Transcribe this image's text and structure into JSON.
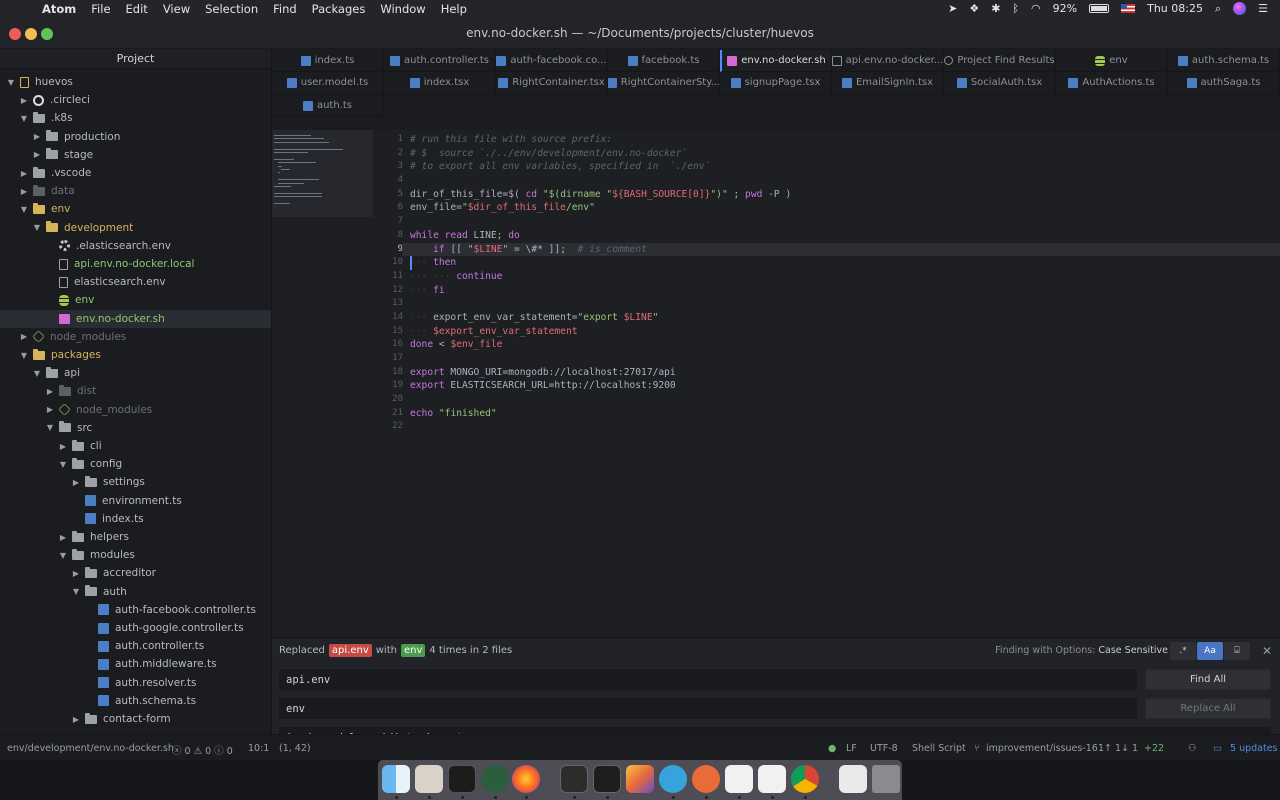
{
  "menubar": {
    "app": "Atom",
    "items": [
      "File",
      "Edit",
      "View",
      "Selection",
      "Find",
      "Packages",
      "Window",
      "Help"
    ],
    "battery": "92%",
    "clock": "Thu 08:25"
  },
  "window": {
    "title": "env.no-docker.sh — ~/Documents/projects/cluster/huevos"
  },
  "sidebar": {
    "header": "Project",
    "rows": [
      {
        "label": "huevos",
        "depth": 0,
        "chev": "down",
        "icon": "repo"
      },
      {
        "label": ".circleci",
        "depth": 1,
        "chev": "right",
        "icon": "ci"
      },
      {
        "label": ".k8s",
        "depth": 1,
        "chev": "down",
        "icon": "folder"
      },
      {
        "label": "production",
        "depth": 2,
        "chev": "right",
        "icon": "folder"
      },
      {
        "label": "stage",
        "depth": 2,
        "chev": "right",
        "icon": "folder"
      },
      {
        "label": ".vscode",
        "depth": 1,
        "chev": "right",
        "icon": "folder"
      },
      {
        "label": "data",
        "depth": 1,
        "chev": "right",
        "icon": "folder-dim",
        "dim": true
      },
      {
        "label": "env",
        "depth": 1,
        "chev": "down",
        "icon": "folder-y",
        "color": "orange"
      },
      {
        "label": "development",
        "depth": 2,
        "chev": "down",
        "icon": "folder-y",
        "color": "orange"
      },
      {
        "label": ".elasticsearch.env",
        "depth": 3,
        "icon": "gear"
      },
      {
        "label": "api.env.no-docker.local",
        "depth": 3,
        "icon": "file",
        "color": "green"
      },
      {
        "label": "elasticsearch.env",
        "depth": 3,
        "icon": "file"
      },
      {
        "label": "env",
        "depth": 3,
        "icon": "db",
        "color": "green"
      },
      {
        "label": "env.no-docker.sh",
        "depth": 3,
        "icon": "sh",
        "color": "green",
        "selected": true
      },
      {
        "label": "node_modules",
        "depth": 1,
        "chev": "right",
        "icon": "hex",
        "dim": true
      },
      {
        "label": "packages",
        "depth": 1,
        "chev": "down",
        "icon": "folder-y",
        "color": "orange"
      },
      {
        "label": "api",
        "depth": 2,
        "chev": "down",
        "icon": "folder"
      },
      {
        "label": "dist",
        "depth": 3,
        "chev": "right",
        "icon": "folder-dim",
        "dim": true
      },
      {
        "label": "node_modules",
        "depth": 3,
        "chev": "right",
        "icon": "hex",
        "dim": true
      },
      {
        "label": "src",
        "depth": 3,
        "chev": "down",
        "icon": "folder"
      },
      {
        "label": "cli",
        "depth": 4,
        "chev": "right",
        "icon": "folder"
      },
      {
        "label": "config",
        "depth": 4,
        "chev": "down",
        "icon": "folder"
      },
      {
        "label": "settings",
        "depth": 5,
        "chev": "right",
        "icon": "folder"
      },
      {
        "label": "environment.ts",
        "depth": 5,
        "icon": "ts"
      },
      {
        "label": "index.ts",
        "depth": 5,
        "icon": "ts"
      },
      {
        "label": "helpers",
        "depth": 4,
        "chev": "right",
        "icon": "folder"
      },
      {
        "label": "modules",
        "depth": 4,
        "chev": "down",
        "icon": "folder"
      },
      {
        "label": "accreditor",
        "depth": 5,
        "chev": "right",
        "icon": "folder"
      },
      {
        "label": "auth",
        "depth": 5,
        "chev": "down",
        "icon": "folder"
      },
      {
        "label": "auth-facebook.controller.ts",
        "depth": 6,
        "icon": "ts"
      },
      {
        "label": "auth-google.controller.ts",
        "depth": 6,
        "icon": "ts"
      },
      {
        "label": "auth.controller.ts",
        "depth": 6,
        "icon": "ts"
      },
      {
        "label": "auth.middleware.ts",
        "depth": 6,
        "icon": "ts"
      },
      {
        "label": "auth.resolver.ts",
        "depth": 6,
        "icon": "ts"
      },
      {
        "label": "auth.schema.ts",
        "depth": 6,
        "icon": "ts"
      },
      {
        "label": "contact-form",
        "depth": 5,
        "chev": "right",
        "icon": "folder"
      }
    ]
  },
  "tabs": [
    [
      {
        "label": "index.ts",
        "icon": "ts"
      },
      {
        "label": "auth.controller.ts",
        "icon": "ts"
      },
      {
        "label": "auth-facebook.co...",
        "icon": "ts"
      },
      {
        "label": "facebook.ts",
        "icon": "ts"
      },
      {
        "label": "env.no-docker.sh",
        "icon": "sh",
        "active": true
      },
      {
        "label": "api.env.no-docker...",
        "icon": "file"
      },
      {
        "label": "Project Find Results",
        "icon": "search"
      },
      {
        "label": "env",
        "icon": "db"
      },
      {
        "label": "auth.schema.ts",
        "icon": "ts"
      }
    ],
    [
      {
        "label": "user.model.ts",
        "icon": "ts"
      },
      {
        "label": "index.tsx",
        "icon": "ts"
      },
      {
        "label": "RightContainer.tsx",
        "icon": "ts"
      },
      {
        "label": "RightContainerSty...",
        "icon": "ts"
      },
      {
        "label": "signupPage.tsx",
        "icon": "ts"
      },
      {
        "label": "EmailSignIn.tsx",
        "icon": "ts"
      },
      {
        "label": "SocialAuth.tsx",
        "icon": "ts"
      },
      {
        "label": "AuthActions.ts",
        "icon": "ts"
      },
      {
        "label": "authSaga.ts",
        "icon": "ts"
      }
    ],
    [
      {
        "label": "auth.ts",
        "icon": "ts"
      }
    ]
  ],
  "editor": {
    "current_line": 9,
    "lines": [
      "# run this file with source prefix:",
      "# $  source `./../env/development/env.no-docker`",
      "# to export all env variables, specified in  `./env`",
      "",
      "dir_of_this_file=$( cd \"$(dirname \"${BASH_SOURCE[0]}\")\" ; pwd -P )",
      "env_file=\"$dir_of_this_file/env\"",
      "",
      "while read LINE; do",
      "    if [[ \"$LINE\" = \\#* ]];  # is_comment",
      "    then",
      "        continue",
      "    fi",
      "",
      "    export_env_var_statement=\"export $LINE\"",
      "    $export_env_var_statement",
      "done < $env_file",
      "",
      "export MONGO_URI=mongodb://localhost:27017/api",
      "export ELASTICSEARCH_URL=http://localhost:9200",
      "",
      "echo \"finished\"",
      ""
    ]
  },
  "find": {
    "msg_replaced": "Replaced",
    "msg_from": "api.env",
    "msg_with": "with",
    "msg_to": "env",
    "msg_tail": "4 times in 2 files",
    "options_label": "Finding with Options:",
    "options_value": "Case Sensitive",
    "opt_regex": ".*",
    "opt_case": "Aa",
    "opt_word": "⌸",
    "find_value": "api.env",
    "replace_value": "env",
    "paths_value": "!node_modules, !dist, !.next",
    "find_all": "Find All",
    "replace_all": "Replace All"
  },
  "status": {
    "path": "env/development/env.no-docker.sh",
    "diagnostics": "ⓧ 0 ⚠ 0 ⓘ 0",
    "line_col": "10:1",
    "selection": "(1, 42)",
    "eol": "LF",
    "encoding": "UTF-8",
    "grammar": "Shell Script",
    "branch": "improvement/issues-16",
    "sync": "1↑ 1↓ 1",
    "diff": "+22",
    "updates": "5 updates"
  },
  "colors": {
    "accent": "#528bff",
    "tree_green": "#8fc86f",
    "tree_orange": "#d6b45a"
  }
}
